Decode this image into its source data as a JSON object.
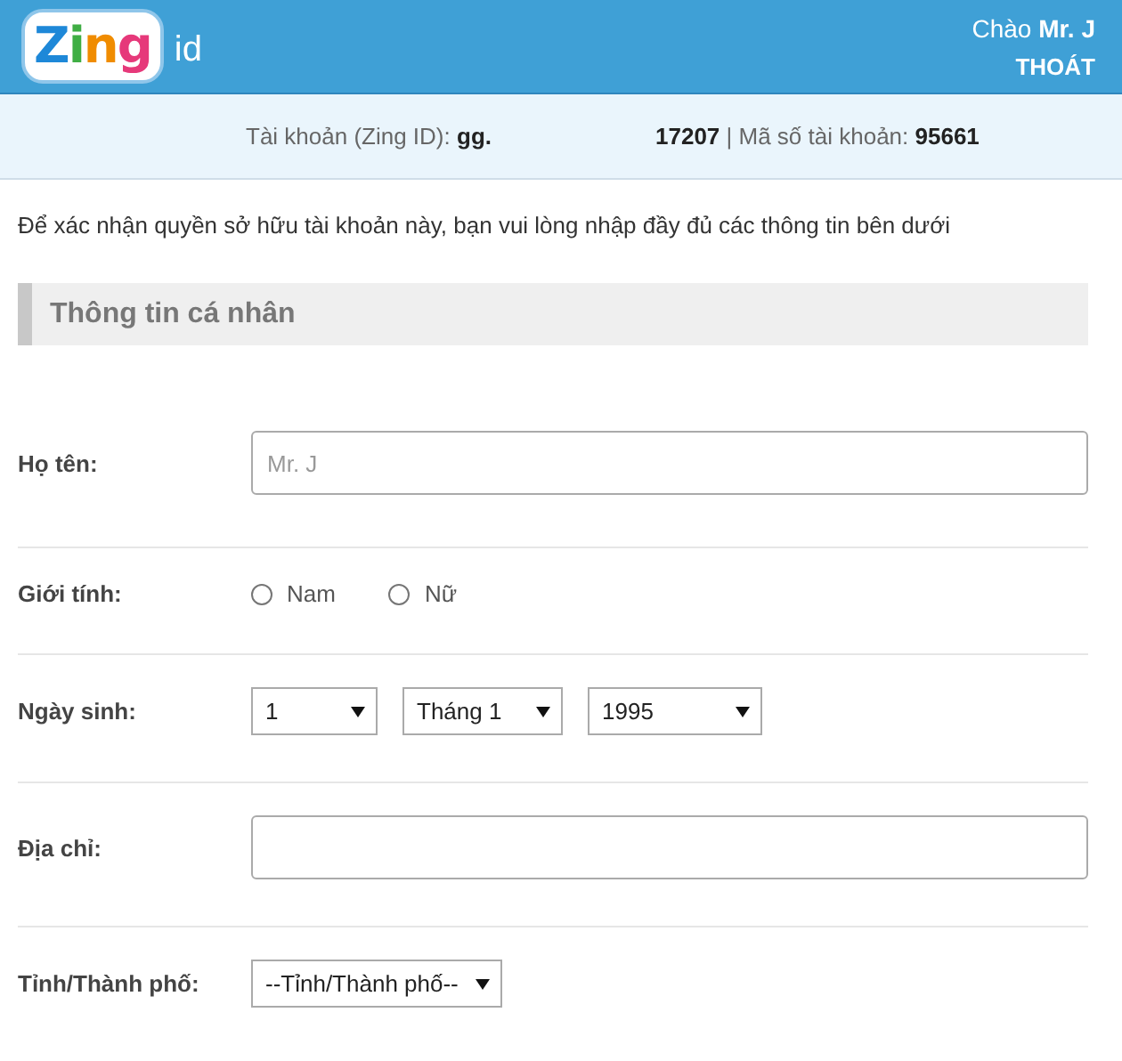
{
  "header": {
    "logo": "Zing",
    "logo_suffix": "id",
    "greeting": "Chào **Mr. J**",
    "logout": "THOÁT"
  },
  "account_bar": {
    "account": "Tài khoản (Zing ID): **gg.**",
    "account_number": "**17207** | Mã số tài khoản: **95661**"
  },
  "intro": "Để xác nhận quyền sở hữu tài khoản này, bạn vui lòng nhập đầy đủ các thông tin bên dưới",
  "section_title": "Thông tin cá nhân",
  "rows": [
    {
      "kind": "text",
      "label": "Họ tên:",
      "placeholder": "Mr. J"
    },
    {
      "kind": "radio",
      "label": "Giới tính:",
      "options": [
        {
          "label": "Nam",
          "selected": false
        },
        {
          "label": "Nữ",
          "selected": false
        }
      ]
    },
    {
      "kind": "selects",
      "label": "Ngày sinh:",
      "selects": [
        "1",
        "Tháng 1",
        "1995"
      ]
    },
    {
      "kind": "text",
      "label": "Địa chỉ:"
    },
    {
      "kind": "selects",
      "label": "Tỉnh/Thành phố:",
      "selects": [
        "--Tỉnh/Thành phố--"
      ]
    }
  ]
}
